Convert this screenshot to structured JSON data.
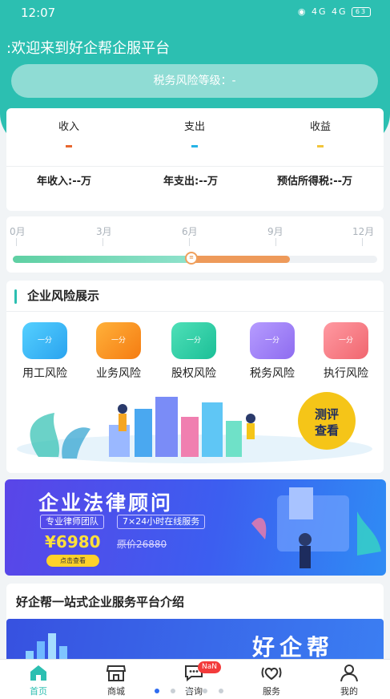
{
  "status_bar": {
    "time": "12:07",
    "signal_text": "4G 4G",
    "battery": "63"
  },
  "header": {
    "welcome": ":欢迎来到好企帮企服平台",
    "risk_level_label": "税务风险等级：-"
  },
  "finance_summary": {
    "columns": [
      {
        "label": "收入",
        "color": "#e8672f"
      },
      {
        "label": "支出",
        "color": "#26b3e6"
      },
      {
        "label": "收益",
        "color": "#f2c53a"
      }
    ],
    "annual_income": "年收入:--万",
    "annual_expense": "年支出:--万",
    "estimated_tax": "预估所得税:--万"
  },
  "timeline": {
    "months": [
      "0月",
      "3月",
      "6月",
      "9月",
      "12月"
    ],
    "progress_green_fraction": 0.49,
    "progress_orange_fraction": 0.76
  },
  "enterprise_risk": {
    "title": "企业风险展示",
    "items": [
      {
        "label": "用工风险",
        "score": "一分",
        "icon": "employment-risk-icon",
        "color": "#32b7f0"
      },
      {
        "label": "业务风险",
        "score": "一分",
        "icon": "business-risk-icon",
        "color": "#f7941e"
      },
      {
        "label": "股权风险",
        "score": "一分",
        "icon": "equity-risk-icon",
        "color": "#2ccfa6"
      },
      {
        "label": "税务风险",
        "score": "一分",
        "icon": "tax-risk-icon",
        "color": "#9c7df2"
      },
      {
        "label": "执行风险",
        "score": "一分",
        "icon": "execution-risk-icon",
        "color": "#f2707a"
      }
    ],
    "evaluate_button": "测评查看"
  },
  "legal_banner": {
    "title": "企业法律顾问",
    "tag1": "专业律师团队",
    "tag2": "7×24小时在线服务",
    "price": "¥6980",
    "original_price": "原价26880",
    "button": "点击查看"
  },
  "intro": {
    "title": "好企帮一站式企业服务平台介绍",
    "brand": "好企帮"
  },
  "tabbar": {
    "items": [
      {
        "label": "首页",
        "icon": "home-icon",
        "active": true
      },
      {
        "label": "商城",
        "icon": "shop-icon",
        "active": false
      },
      {
        "label": "咨询",
        "icon": "chat-icon",
        "active": false,
        "badge": "NaN"
      },
      {
        "label": "服务",
        "icon": "service-icon",
        "active": false
      },
      {
        "label": "我的",
        "icon": "profile-icon",
        "active": false
      }
    ]
  },
  "colors": {
    "primary": "#2cbfb1",
    "banner": "#4a52ec",
    "price": "#ffe03a"
  }
}
